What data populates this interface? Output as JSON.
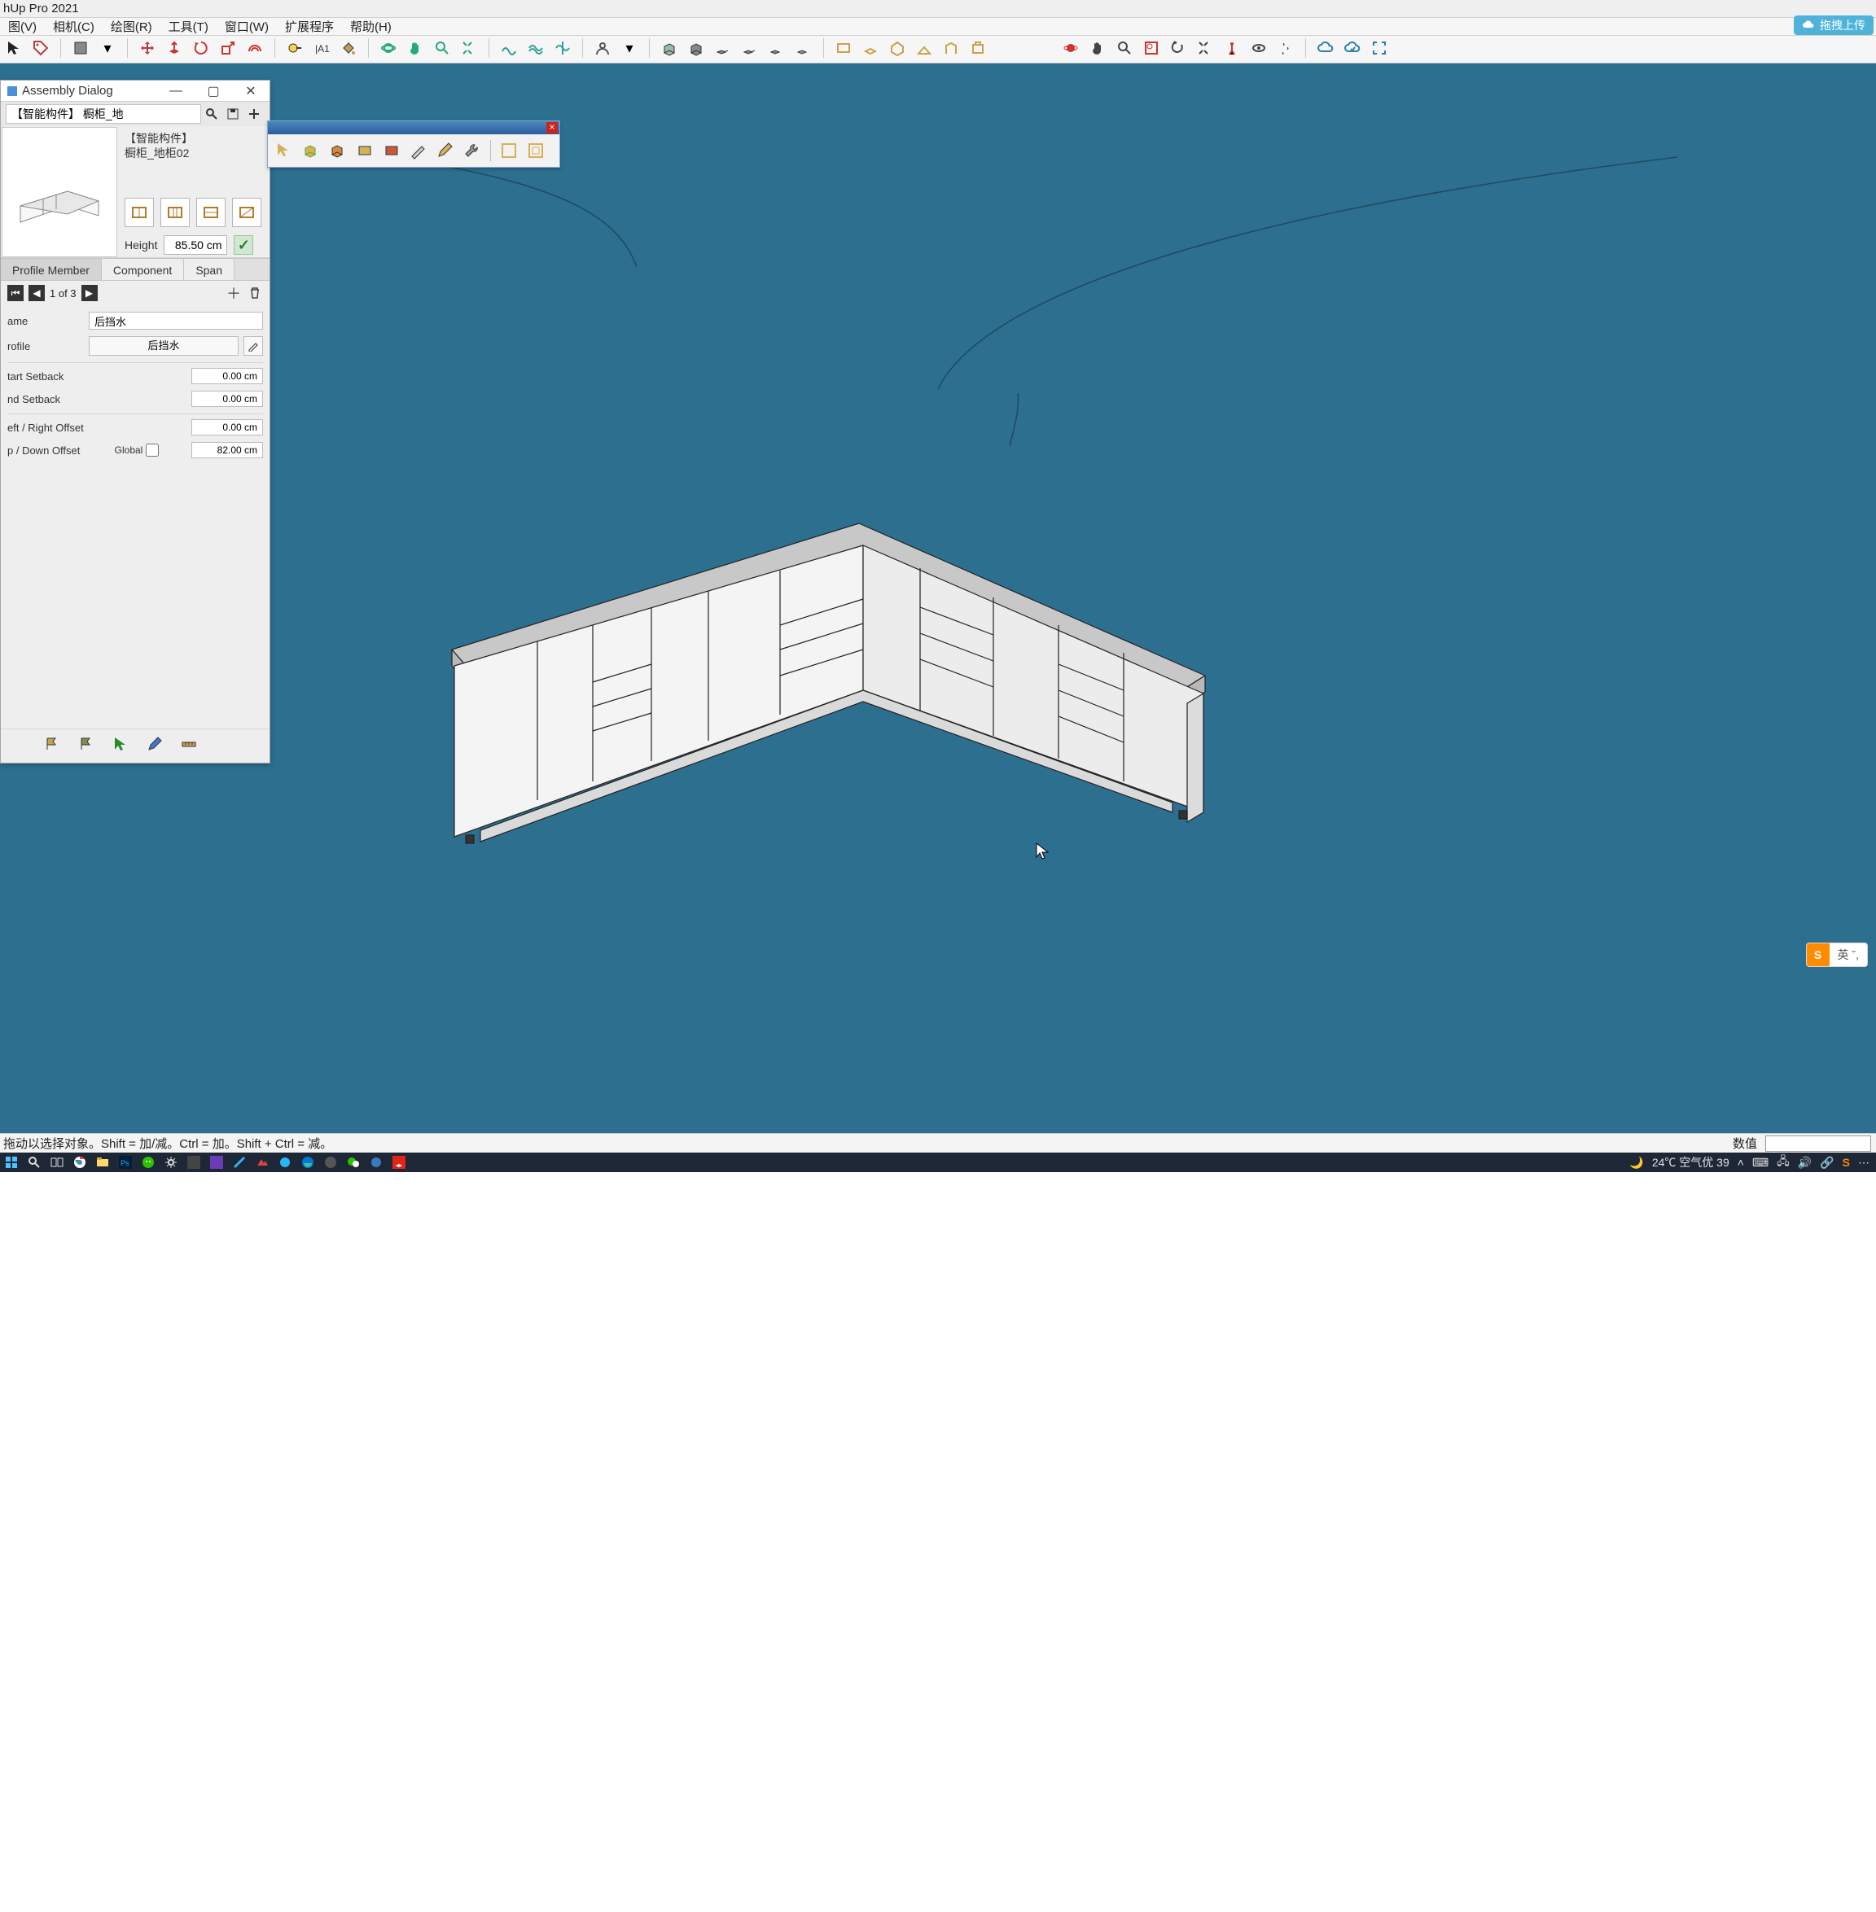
{
  "app": {
    "title": "hUp Pro 2021"
  },
  "menu": {
    "items": [
      "图(V)",
      "相机(C)",
      "绘图(R)",
      "工具(T)",
      "窗口(W)",
      "扩展程序",
      "帮助(H)"
    ]
  },
  "toppill": {
    "text": "拖拽上传",
    "icon": "cloud"
  },
  "assembly": {
    "title": "Assembly Dialog",
    "search_value": "【智能构件】 橱柜_地",
    "component_label1": "【智能构件】",
    "component_label2": "橱柜_地柜02",
    "height_label": "Height",
    "height_value": "85.50 cm",
    "tabs": {
      "profile": "Profile Member",
      "component": "Component",
      "span": "Span"
    },
    "pager": {
      "text": "1 of 3"
    },
    "name_label": "ame",
    "name_value": "后挡水",
    "profile_label": "rofile",
    "profile_btn": "后挡水",
    "start_setback_label": "tart Setback",
    "start_setback_value": "0.00 cm",
    "end_setback_label": "nd Setback",
    "end_setback_value": "0.00 cm",
    "left_right_label": "eft / Right Offset",
    "left_right_value": "0.00 cm",
    "up_down_label": "p / Down Offset",
    "up_down_value": "82.00 cm",
    "global_label": "Global"
  },
  "status": {
    "left": "拖动以选择对象。Shift = 加/减。Ctrl = 加。Shift + Ctrl = 减。",
    "measure_label": "数值"
  },
  "taskbar": {
    "weather": "24℃ 空气优 39"
  },
  "ime": {
    "badge": "S",
    "text": "英 ˇ,"
  },
  "icons": {
    "cursor": "▲",
    "pencil": "✎",
    "paint": "▦",
    "tape": "◠",
    "red": "●",
    "orbit": "◐",
    "sync": "⟳",
    "cloud": "☁",
    "expand": "⛶"
  }
}
